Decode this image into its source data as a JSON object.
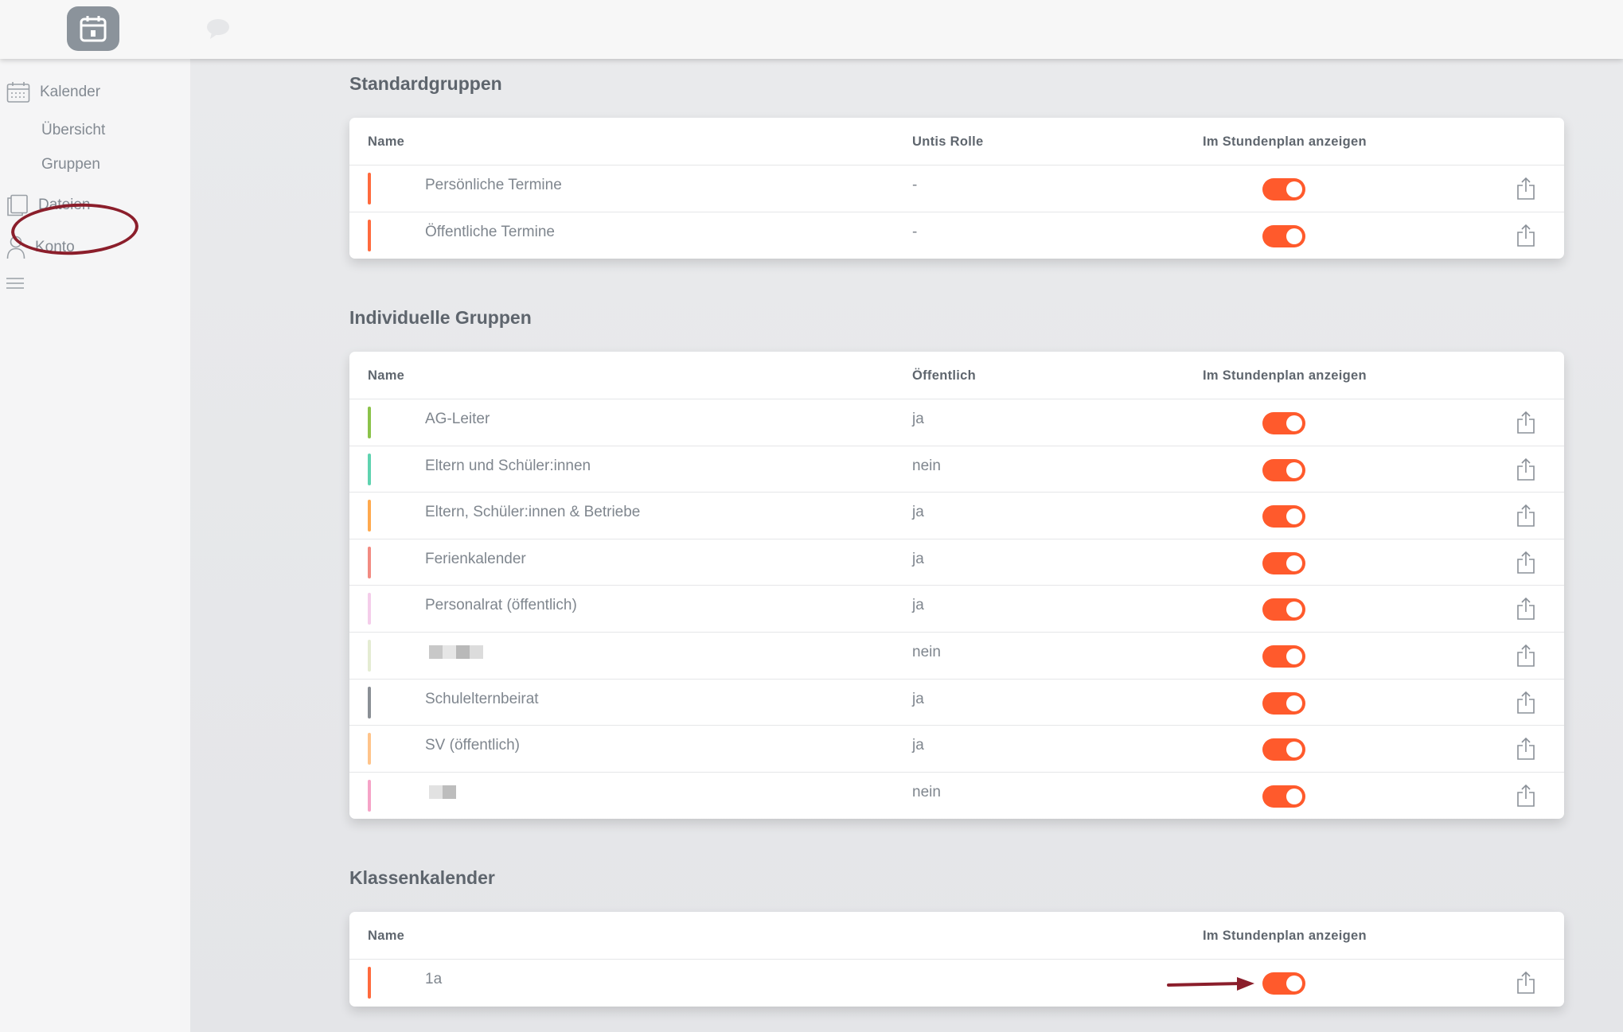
{
  "sidebar": {
    "kalender": "Kalender",
    "uebersicht": "Übersicht",
    "gruppen": "Gruppen",
    "dateien": "Dateien",
    "konto": "Konto"
  },
  "sections": [
    {
      "title": "Standardgruppen",
      "headers": [
        "Name",
        "Untis Rolle",
        "Im Stundenplan anzeigen"
      ],
      "rows": [
        {
          "name": "Persönliche Termine",
          "value": "-",
          "color": "#ff6a3d",
          "enabled": true
        },
        {
          "name": "Öffentliche Termine",
          "value": "-",
          "color": "#ff6a3d",
          "enabled": true
        }
      ]
    },
    {
      "title": "Individuelle Gruppen",
      "headers": [
        "Name",
        "Öffentlich",
        "Im Stundenplan anzeigen"
      ],
      "rows": [
        {
          "name": "AG-Leiter",
          "value": "ja",
          "color": "#8bc34a",
          "enabled": true
        },
        {
          "name": "Eltern und Schüler:innen",
          "value": "nein",
          "color": "#5fd3b0",
          "enabled": true
        },
        {
          "name": "Eltern, Schüler:innen & Betriebe",
          "value": "ja",
          "color": "#ffa94d",
          "enabled": true
        },
        {
          "name": "Ferienkalender",
          "value": "ja",
          "color": "#f28b82",
          "enabled": true
        },
        {
          "name": "Personalrat (öffentlich)",
          "value": "ja",
          "color": "#f4cdea",
          "enabled": true
        },
        {
          "name": "",
          "value": "nein",
          "color": "#e4ecd2",
          "enabled": true,
          "redacted": true
        },
        {
          "name": "Schulelternbeirat",
          "value": "ja",
          "color": "#8a8f95",
          "enabled": true
        },
        {
          "name": "SV (öffentlich)",
          "value": "ja",
          "color": "#ffc48a",
          "enabled": true
        },
        {
          "name": "",
          "value": "nein",
          "color": "#f5a3c7",
          "enabled": true,
          "redacted": true
        }
      ]
    },
    {
      "title": "Klassenkalender",
      "headers": [
        "Name",
        "",
        "Im Stundenplan anzeigen"
      ],
      "rows": [
        {
          "name": "1a",
          "value": "",
          "color": "#ff6a3d",
          "enabled": true
        }
      ]
    }
  ]
}
